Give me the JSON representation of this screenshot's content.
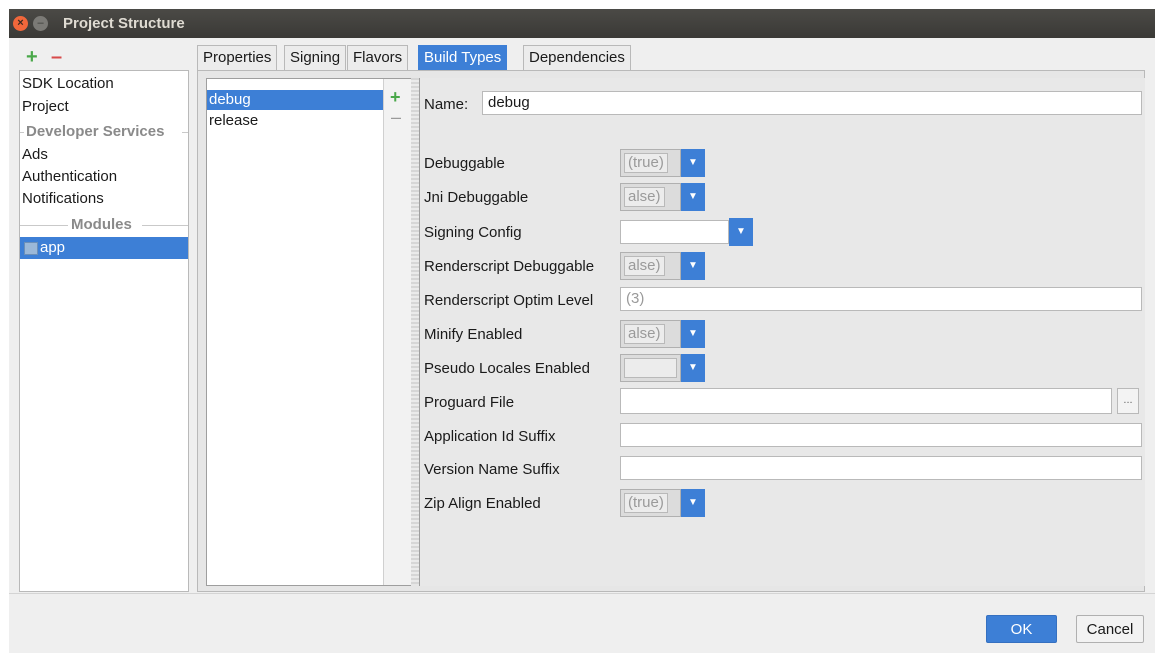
{
  "window": {
    "title": "Project Structure",
    "close_glyph": "×",
    "minimize_glyph": "–"
  },
  "toolbar": {
    "add_glyph": "+",
    "remove_glyph": "–"
  },
  "sidebar": {
    "items": [
      {
        "label": "SDK Location"
      },
      {
        "label": "Project"
      }
    ],
    "section_developer_services": "Developer Services",
    "services": [
      {
        "label": "Ads"
      },
      {
        "label": "Authentication"
      },
      {
        "label": "Notifications"
      }
    ],
    "section_modules": "Modules",
    "module": {
      "label": "app",
      "icon": "module-folder-icon",
      "selected": true
    }
  },
  "tabs": [
    {
      "label": "Properties"
    },
    {
      "label": "Signing"
    },
    {
      "label": "Flavors"
    },
    {
      "label": "Build Types",
      "active": true
    },
    {
      "label": "Dependencies"
    }
  ],
  "build_types": {
    "items": [
      {
        "label": "debug",
        "selected": true
      },
      {
        "label": "release"
      }
    ],
    "add_glyph": "+",
    "remove_glyph": "–"
  },
  "form": {
    "name_label": "Name:",
    "name_value": "debug",
    "fields": {
      "debuggable": {
        "label": "Debuggable",
        "value": "(true)"
      },
      "jni_debuggable": {
        "label": "Jni Debuggable",
        "value": "alse)"
      },
      "signing_config": {
        "label": "Signing Config",
        "value": ""
      },
      "renderscript_debuggable": {
        "label": "Renderscript Debuggable",
        "value": "alse)"
      },
      "renderscript_optim_level": {
        "label": "Renderscript Optim Level",
        "value": "(3)"
      },
      "minify_enabled": {
        "label": "Minify Enabled",
        "value": "alse)"
      },
      "pseudo_locales_enabled": {
        "label": "Pseudo Locales Enabled",
        "value": ""
      },
      "proguard_file": {
        "label": "Proguard File",
        "value": "",
        "browse_glyph": "..."
      },
      "application_id_suffix": {
        "label": "Application Id Suffix",
        "value": ""
      },
      "version_name_suffix": {
        "label": "Version Name Suffix",
        "value": ""
      },
      "zip_align_enabled": {
        "label": "Zip Align Enabled",
        "value": "(true)"
      }
    },
    "dropdown_glyph": "▼"
  },
  "footer": {
    "ok_label": "OK",
    "cancel_label": "Cancel"
  },
  "colors": {
    "accent": "#3d7fd6",
    "add": "#4aa84a",
    "remove": "#d84a4a",
    "titlebar": "#3c3b37"
  }
}
